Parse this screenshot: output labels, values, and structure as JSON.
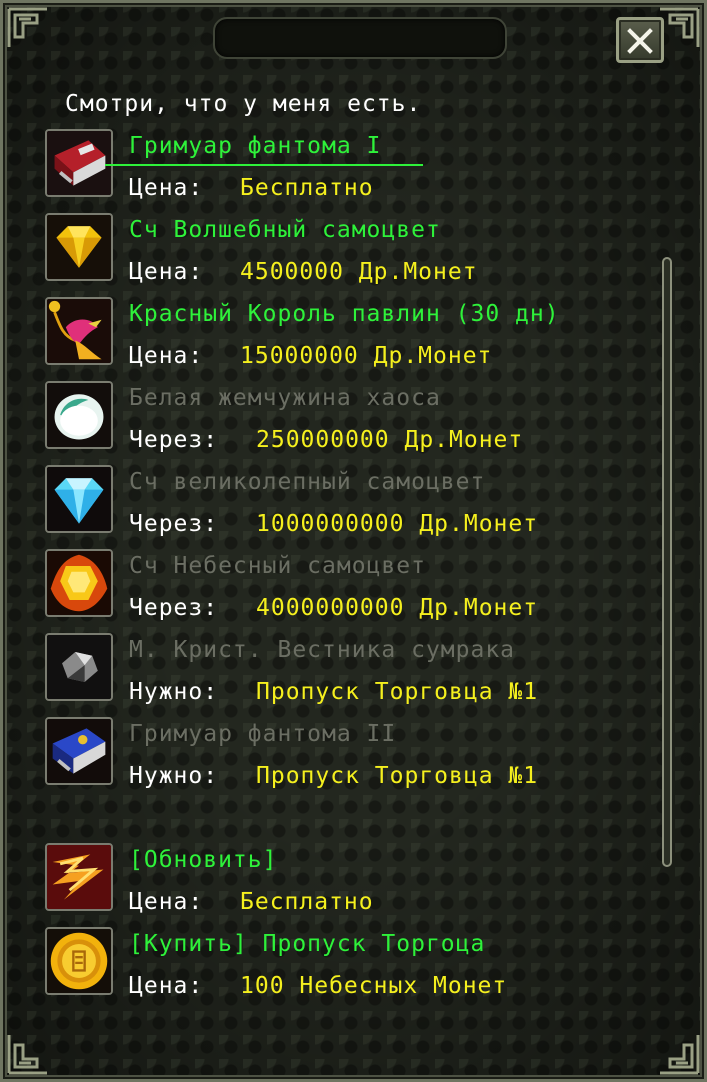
{
  "header": {
    "greeting": "Смотри, что у меня есть."
  },
  "colors": {
    "available": "#2ef23a",
    "unavailable": "#6b6e63",
    "price": "#f5f01e",
    "label": "#ffffff"
  },
  "items": [
    {
      "name": "Гримуар фантома I",
      "label": "Цена:",
      "value": "Бесплатно",
      "available": true,
      "icon": "red-grimoire-icon"
    },
    {
      "name": "Сч Волшебный самоцвет",
      "label": "Цена:",
      "value": "4500000 Др.Монет",
      "available": true,
      "icon": "yellow-gem-icon"
    },
    {
      "name": "Красный Король павлин (30 дн)",
      "label": "Цена:",
      "value": "15000000 Др.Монет",
      "available": true,
      "icon": "red-peacock-icon"
    },
    {
      "name": "Белая жемчужина хаоса",
      "label": "Через:",
      "value": "250000000 Др.Монет",
      "available": false,
      "icon": "white-pearl-icon"
    },
    {
      "name": "Сч великолепный самоцвет",
      "label": "Через:",
      "value": "1000000000 Др.Монет",
      "available": false,
      "icon": "blue-diamond-icon"
    },
    {
      "name": "Сч Небесный самоцвет",
      "label": "Через:",
      "value": "4000000000 Др.Монет",
      "available": false,
      "icon": "golden-gem-icon"
    },
    {
      "name": "М. Крист. Вестника сумрака",
      "label": "Нужно:",
      "value": "Пропуск Торговца №1",
      "available": false,
      "icon": "dark-crystal-icon"
    },
    {
      "name": "Гримуар фантома II",
      "label": "Нужно:",
      "value": "Пропуск Торговца №1",
      "available": false,
      "icon": "blue-grimoire-icon"
    },
    {
      "name": "[Обновить]",
      "label": "Цена:",
      "value": "Бесплатно",
      "available": true,
      "icon": "lightning-refresh-icon"
    },
    {
      "name": "[Купить] Пропуск Торгоца",
      "label": "Цена:",
      "value": "100 Небесных Монет",
      "available": true,
      "icon": "gold-coin-icon"
    }
  ]
}
